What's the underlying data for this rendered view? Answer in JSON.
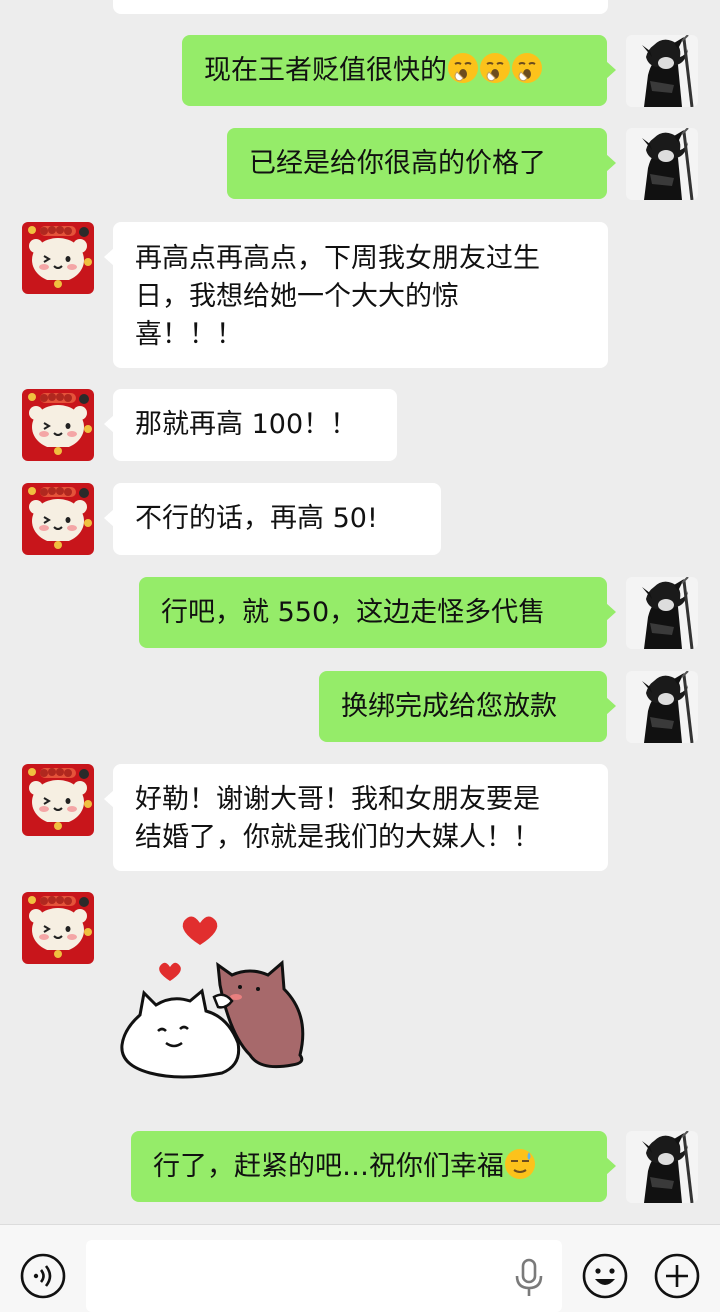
{
  "messages": [
    {
      "side": "right",
      "text": "现在王者贬值很快的",
      "emojis": [
        "yawning-face",
        "yawning-face",
        "yawning-face"
      ]
    },
    {
      "side": "right",
      "text": "已经是给你很高的价格了"
    },
    {
      "side": "left",
      "lines": [
        "再高点再高点，下周我女朋友过生",
        "日，我想给她一个大大的惊",
        "喜！！！"
      ]
    },
    {
      "side": "left",
      "text": "那就再高 100！！"
    },
    {
      "side": "left",
      "text": "不行的话，再高 50!"
    },
    {
      "side": "right",
      "text": "行吧，就 550，这边走怪多代售"
    },
    {
      "side": "right",
      "text": "换绑完成给您放款"
    },
    {
      "side": "left",
      "lines": [
        "好勒！谢谢大哥！我和女朋友要是",
        "结婚了，你就是我们的大媒人！！"
      ]
    },
    {
      "side": "left",
      "sticker": "cat-couple-hearts-sticker"
    },
    {
      "side": "right",
      "text": "行了，赶紧的吧…祝你们幸福",
      "emojis": [
        "sweat-smile-face"
      ]
    }
  ],
  "avatars": {
    "left": "cartoon-bear-avatar",
    "right": "dark-anime-character-avatar"
  },
  "input_bar": {
    "placeholder": "",
    "left_icon": "voice-mode-icon",
    "mic_icon": "microphone-icon",
    "emoji_icon": "emoji-icon",
    "plus_icon": "plus-icon"
  },
  "colors": {
    "background": "#ededed",
    "right_bubble": "#95ec69",
    "left_bubble": "#ffffff"
  }
}
